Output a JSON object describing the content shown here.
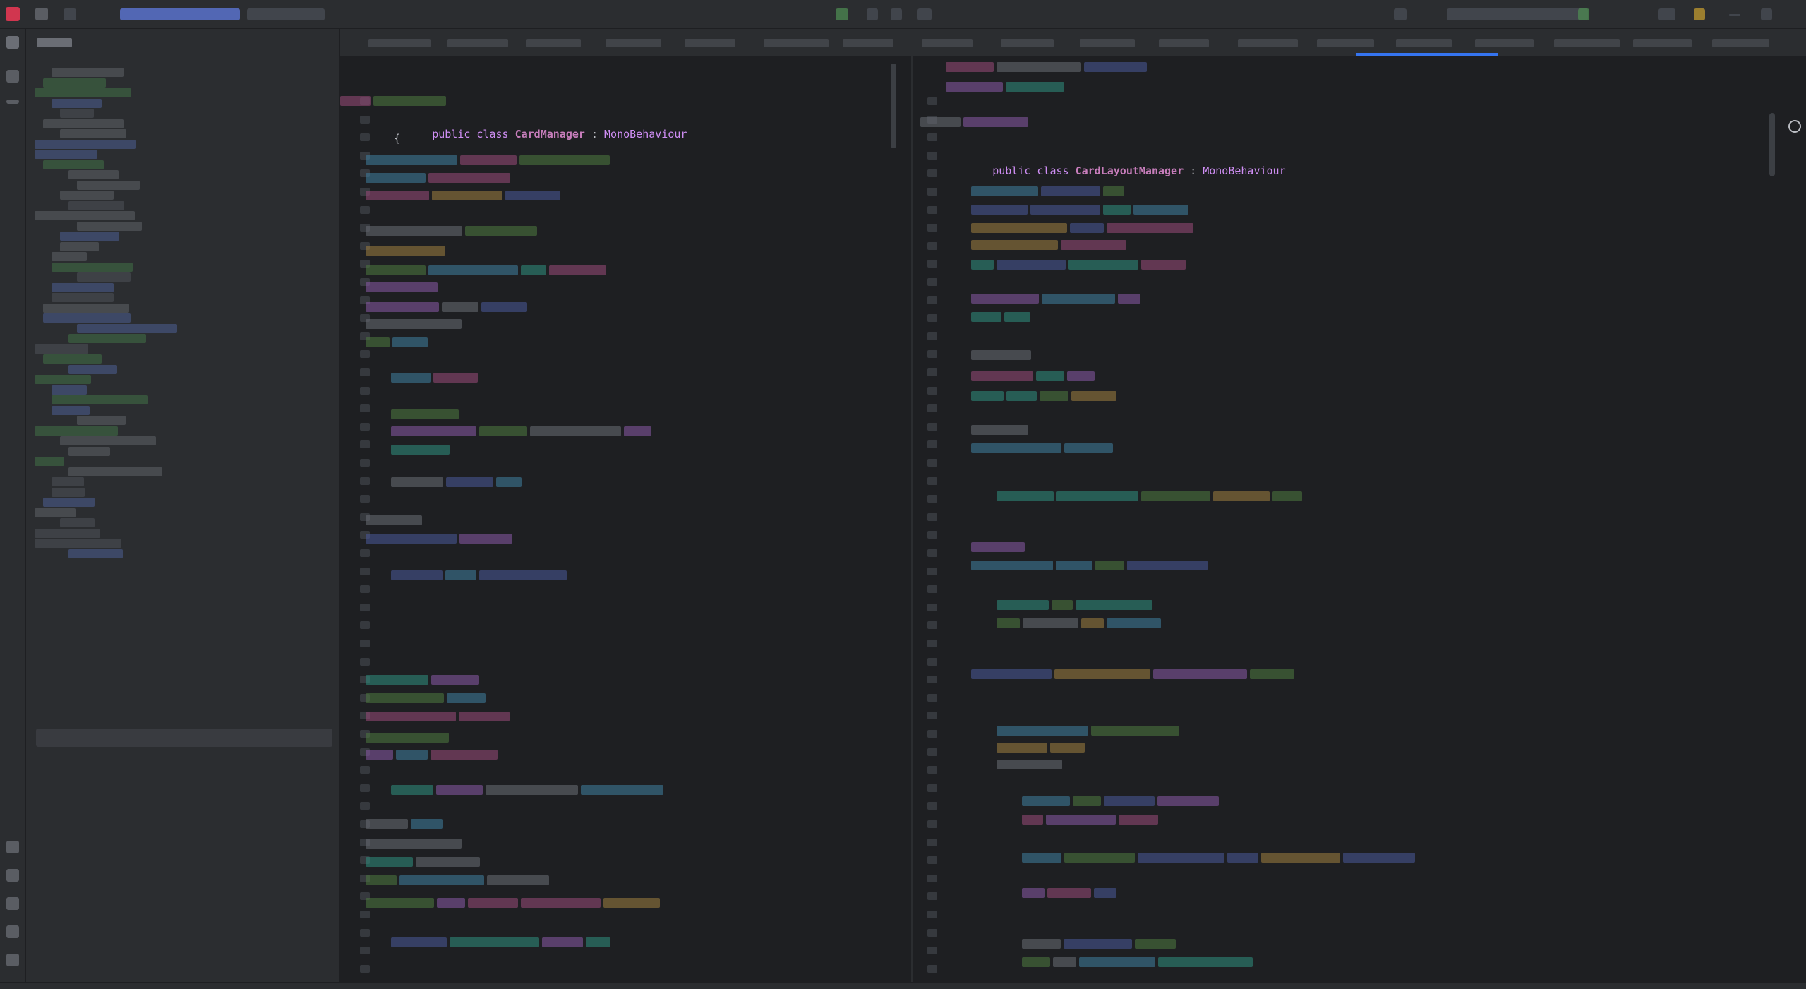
{
  "editors": {
    "left": {
      "code_line": {
        "kw_public": "public",
        "kw_class": "class",
        "class_name": "CardManager",
        "colon": ":",
        "base_type": "MonoBehaviour"
      },
      "brace": "{"
    },
    "right": {
      "code_line": {
        "kw_public": "public",
        "kw_class": "class",
        "class_name": "CardLayoutManager",
        "colon": ":",
        "base_type": "MonoBehaviour"
      },
      "brace": "{"
    }
  },
  "colors": {
    "background": "#1e1f22",
    "panel": "#2b2d30",
    "keyword": "#cf8ef4",
    "class_name": "#c77dbb",
    "accent": "#3574f0",
    "string": "#6aab73",
    "type": "#56a8f5",
    "field": "#2fbfa0"
  },
  "icons": {
    "app_logo": "app-logo-icon",
    "project_tool": "folder-icon",
    "structure_tool": "structure-icon",
    "editor_option": "gear-icon"
  }
}
